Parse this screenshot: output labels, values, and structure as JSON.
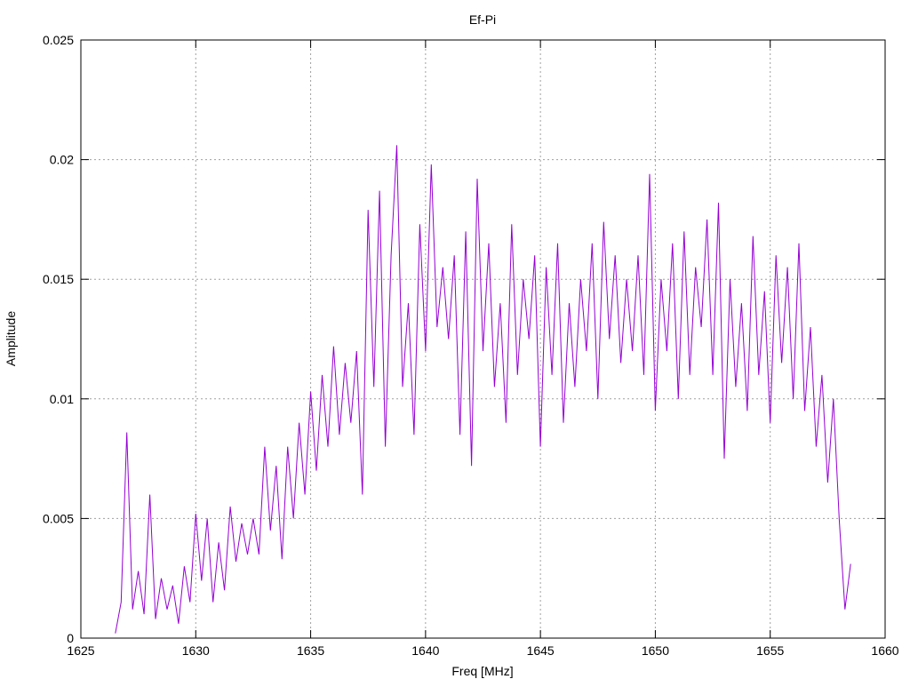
{
  "chart_data": {
    "type": "line",
    "title": "Ef-Pi",
    "xlabel": "Freq [MHz]",
    "ylabel": "Amplitude",
    "xlim": [
      1625,
      1660
    ],
    "ylim": [
      0,
      0.025
    ],
    "grid": true,
    "legend": "none",
    "x_ticks": [
      "1625",
      "1630",
      "1635",
      "1640",
      "1645",
      "1650",
      "1655",
      "1660"
    ],
    "y_ticks": [
      "0",
      "0.005",
      "0.01",
      "0.015",
      "0.02",
      "0.025"
    ],
    "series": [
      {
        "name": "Ef-Pi",
        "color": "#9400d3",
        "x_start": 1626.5,
        "x_step": 0.25,
        "values_milli": [
          0.2,
          1.5,
          8.6,
          1.2,
          2.8,
          1.0,
          6.0,
          0.8,
          2.5,
          1.2,
          2.2,
          0.6,
          3.0,
          1.5,
          5.2,
          2.4,
          5.0,
          1.5,
          4.0,
          2.0,
          5.5,
          3.2,
          4.8,
          3.5,
          5.0,
          3.5,
          8.0,
          4.5,
          7.2,
          3.3,
          8.0,
          5.0,
          9.0,
          6.0,
          10.3,
          7.0,
          11.0,
          8.0,
          12.2,
          8.5,
          11.5,
          9.0,
          12.0,
          6.0,
          17.9,
          10.5,
          18.7,
          8.0,
          16.0,
          20.6,
          10.5,
          14.0,
          8.5,
          17.3,
          12.0,
          19.8,
          13.0,
          15.5,
          12.5,
          16.0,
          8.5,
          17.0,
          7.2,
          19.2,
          12.0,
          16.5,
          10.5,
          14.0,
          9.0,
          17.3,
          11.0,
          15.0,
          12.5,
          16.0,
          8.0,
          15.5,
          11.0,
          16.5,
          9.0,
          14.0,
          10.5,
          15.0,
          12.0,
          16.5,
          10.0,
          17.4,
          12.5,
          16.0,
          11.5,
          15.0,
          12.0,
          16.0,
          11.0,
          19.4,
          9.5,
          15.0,
          12.0,
          16.5,
          10.0,
          17.0,
          11.0,
          15.5,
          13.0,
          17.5,
          11.0,
          18.2,
          7.5,
          15.0,
          10.5,
          14.0,
          9.5,
          16.8,
          11.0,
          14.5,
          9.0,
          16.0,
          11.5,
          15.5,
          10.0,
          16.5,
          9.5,
          13.0,
          8.0,
          11.0,
          6.5,
          10.0,
          5.0,
          1.2,
          3.1
        ]
      }
    ]
  }
}
